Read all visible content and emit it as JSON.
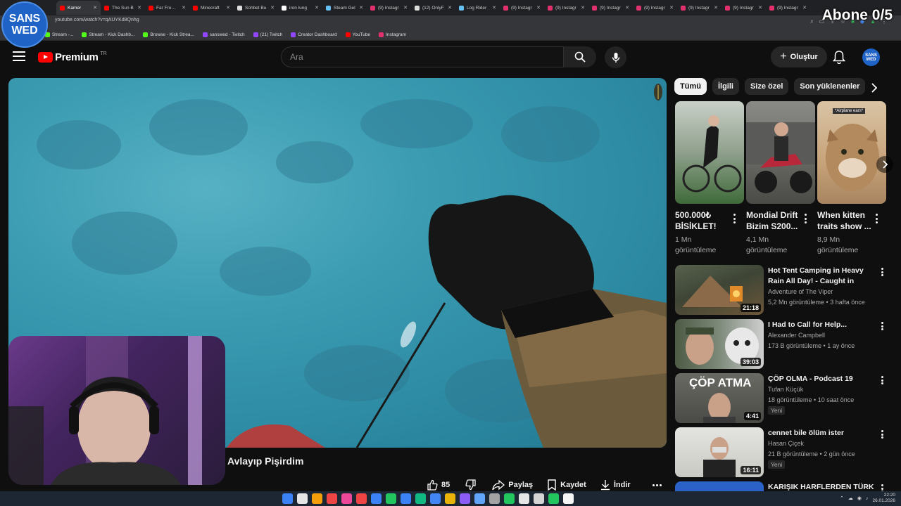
{
  "overlay": {
    "logo_line1": "SANS",
    "logo_line2": "WED",
    "abone": "Abone 0/5"
  },
  "browser": {
    "tabs": [
      {
        "label": "Kamer",
        "color": "#ff0000",
        "active": true
      },
      {
        "label": "The Sun B",
        "color": "#ff0000"
      },
      {
        "label": "Far From A",
        "color": "#ff0000"
      },
      {
        "label": "Minecraft",
        "color": "#ff0000"
      },
      {
        "label": "Sohbet Bu",
        "color": "#dddddd"
      },
      {
        "label": "iron lung",
        "color": "#ffffff"
      },
      {
        "label": "Steam Gel",
        "color": "#66c0f4"
      },
      {
        "label": "(9) Instagr",
        "color": "#e1306c"
      },
      {
        "label": "(12) OnlyF",
        "color": "#dddddd"
      },
      {
        "label": "Log Rider",
        "color": "#66c0f4"
      },
      {
        "label": "(9) Instagr",
        "color": "#e1306c"
      },
      {
        "label": "(9) Instagr",
        "color": "#e1306c"
      },
      {
        "label": "(9) Instagr",
        "color": "#e1306c"
      },
      {
        "label": "(9) Instagr",
        "color": "#e1306c"
      },
      {
        "label": "(9) Instagr",
        "color": "#e1306c"
      },
      {
        "label": "(9) Instagr",
        "color": "#e1306c"
      },
      {
        "label": "(9) Instagr",
        "color": "#e1306c"
      }
    ],
    "url": "youtube.com/watch?v=qAUYKd8Qnhg",
    "bookmarks": [
      {
        "label": "Stream -...",
        "color": "#53fc18"
      },
      {
        "label": "Stream - Kick Dashb...",
        "color": "#53fc18"
      },
      {
        "label": "Browse - Kick Strea...",
        "color": "#53fc18"
      },
      {
        "label": "sanswed - Twitch",
        "color": "#9146ff"
      },
      {
        "label": "(21) Twitch",
        "color": "#9146ff"
      },
      {
        "label": "Creator Dashboard",
        "color": "#9146ff"
      },
      {
        "label": "YouTube",
        "color": "#ff0000"
      },
      {
        "label": "Instagram",
        "color": "#e1306c"
      }
    ]
  },
  "header": {
    "logo_text": "Premium",
    "country": "TR",
    "search_placeholder": "Ara",
    "create_label": "Oluştur",
    "avatar_text": "SANS WED"
  },
  "video": {
    "title": "Avlayıp Pişirdim",
    "like_count": "85",
    "share_label": "Paylaş",
    "save_label": "Kaydet",
    "download_label": "İndir"
  },
  "chips": [
    "Tümü",
    "İlgili",
    "Size özel",
    "Son yüklenenler"
  ],
  "shorts": [
    {
      "title": "500.000₺ BİSİKLET!",
      "views": "1 Mn görüntüleme"
    },
    {
      "title": "Mondial Drift Bizim S200...",
      "views": "4,1 Mn görüntüleme"
    },
    {
      "title": "When kitten traits show ...",
      "views": "8,9 Mn görüntüleme",
      "thumb_text": "*Airplane ears*"
    }
  ],
  "recommendations": [
    {
      "title": "Hot Tent Camping in Heavy Rain All Day! - Caught in Rainstorm ...",
      "channel": "Adventure of The Viper",
      "meta": "5,2 Mn görüntüleme • 3 hafta önce",
      "duration": "21:18",
      "badge": ""
    },
    {
      "title": "I Had to Call for Help...",
      "channel": "Alexander Campbell",
      "meta": "173 B görüntüleme • 1 ay önce",
      "duration": "39:03",
      "badge": ""
    },
    {
      "title": "ÇÖP OLMA - Podcast 19",
      "channel": "Tufan Küçük",
      "meta": "18 görüntüleme • 10 saat önce",
      "duration": "4:41",
      "badge": "Yeni",
      "thumb_text": "ÇÖP ATMA"
    },
    {
      "title": "cennet bile ölüm ister",
      "channel": "Hasan Çiçek",
      "meta": "21 B görüntüleme • 2 gün önce",
      "duration": "16:11",
      "badge": "Yeni"
    },
    {
      "title": "KARIŞIK HARFLERDEN TÜRK",
      "channel": "",
      "meta": "",
      "duration": "",
      "badge": ""
    }
  ],
  "taskbar": {
    "time": "22:20",
    "date": "26.01.2026"
  }
}
